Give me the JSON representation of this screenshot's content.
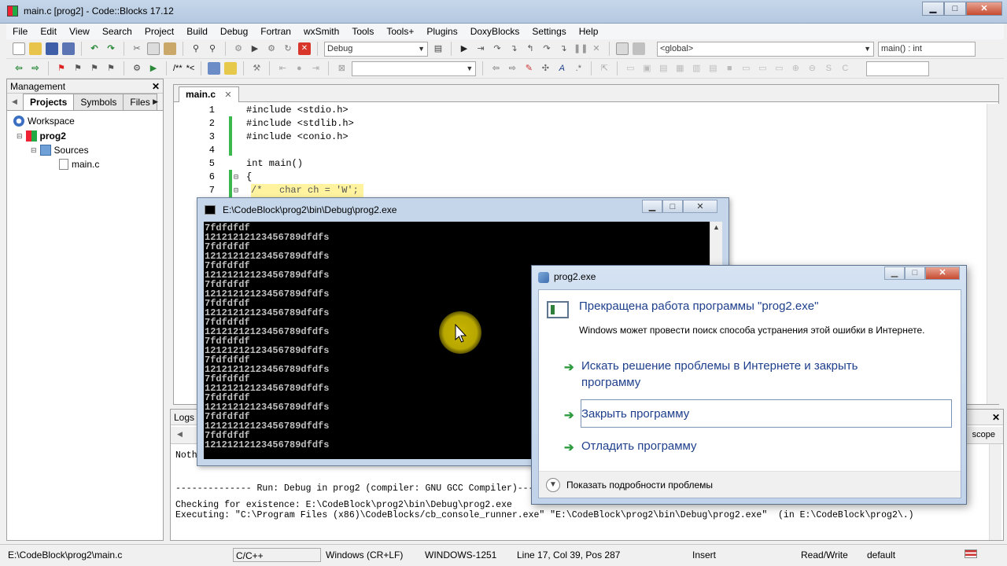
{
  "window": {
    "title": "main.c [prog2] - Code::Blocks 17.12",
    "min_label": "▁",
    "max_label": "□",
    "close_label": "✕"
  },
  "menu": [
    "File",
    "Edit",
    "View",
    "Search",
    "Project",
    "Build",
    "Debug",
    "Fortran",
    "wxSmith",
    "Tools",
    "Tools+",
    "Plugins",
    "DoxyBlocks",
    "Settings",
    "Help"
  ],
  "toolbar": {
    "build_target": "Debug",
    "scope": "<global>",
    "function": "main() : int",
    "comment_labels": [
      "/**",
      "*<"
    ]
  },
  "management": {
    "title": "Management",
    "close": "✕",
    "tabs": [
      "Projects",
      "Symbols",
      "Files"
    ],
    "tree": {
      "workspace": "Workspace",
      "project": "prog2",
      "folder": "Sources",
      "file": "main.c"
    }
  },
  "editor": {
    "tab": "main.c",
    "tab_close": "✕",
    "lines": [
      {
        "no": "1",
        "code": "#include <stdio.h>",
        "kind": "pp"
      },
      {
        "no": "2",
        "code": "#include <stdlib.h>",
        "kind": "pp"
      },
      {
        "no": "3",
        "code": "#include <conio.h>",
        "kind": "pp"
      },
      {
        "no": "4",
        "code": "",
        "kind": "plain"
      },
      {
        "no": "5",
        "code": "int main()",
        "kind": "kw"
      },
      {
        "no": "6",
        "code": "{",
        "kind": "sym"
      },
      {
        "no": "7",
        "code": "/*   char ch = 'W';",
        "kind": "comment"
      }
    ]
  },
  "logs": {
    "tab": "Logs &",
    "right_tab": "scope",
    "lines": [
      "Noth",
      "",
      "",
      "-------------- Run: Debug in prog2 (compiler: GNU GCC Compiler)---",
      "Checking for existence: E:\\CodeBlock\\prog2\\bin\\Debug\\prog2.exe",
      "Executing: \"C:\\Program Files (x86)\\CodeBlocks/cb_console_runner.exe\" \"E:\\CodeBlock\\prog2\\bin\\Debug\\prog2.exe\"  (in E:\\CodeBlock\\prog2\\.)"
    ]
  },
  "console": {
    "title": "E:\\CodeBlock\\prog2\\bin\\Debug\\prog2.exe",
    "output": [
      "7fdfdfdf",
      "121212121234567 89dfdfs"
    ]
  },
  "console_lines": [
    "7fdfdfdf",
    "1212121212345678 9dfdfs"
  ],
  "dialog": {
    "title": "prog2.exe",
    "heading": "Прекращена работа программы \"prog2.exe\"",
    "subtext": "Windows может провести поиск способа устранения этой ошибки в Интернете.",
    "option_1_line1": "Искать решение проблемы в Интернете и закрыть",
    "option_1_line2": "программу",
    "option_2": "Закрыть программу",
    "option_3": "Отладить программу",
    "details": "Показать подробности проблемы"
  },
  "status": {
    "path": "E:\\CodeBlock\\prog2\\main.c",
    "language": "C/C++",
    "eol": "Windows (CR+LF)",
    "encoding": "WINDOWS-1251",
    "position": "Line 17, Col 39, Pos 287",
    "mode": "Insert",
    "access": "Read/Write",
    "profile": "default"
  }
}
